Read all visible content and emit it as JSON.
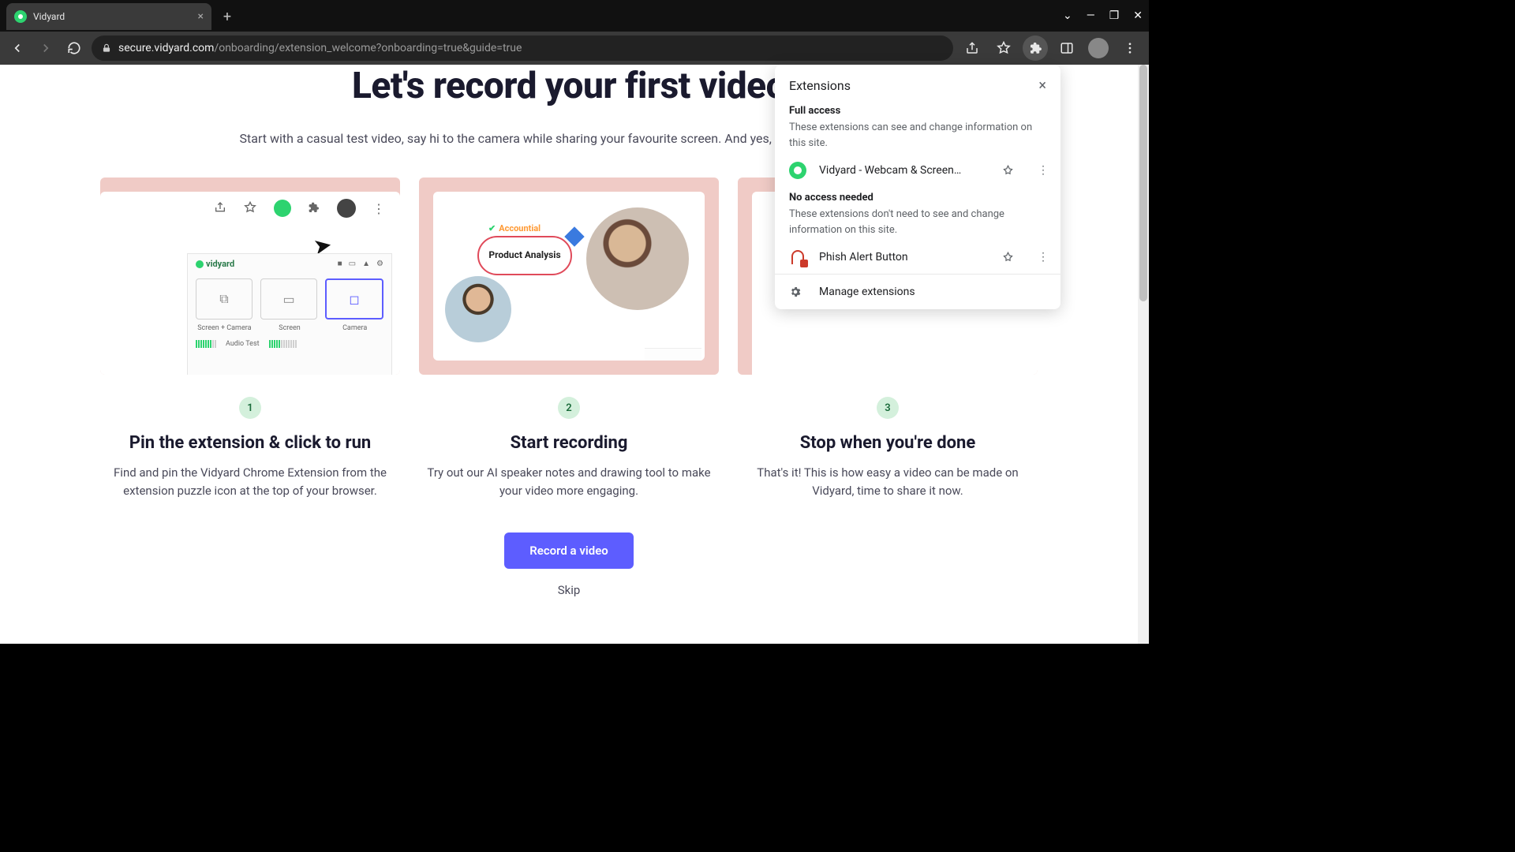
{
  "window": {
    "minimize": "—",
    "maximize": "❐",
    "close": "✕",
    "tabchevron": "⌄"
  },
  "tab": {
    "title": "Vidyard"
  },
  "address": {
    "domain": "secure.vidyard.com",
    "path": "/onboarding/extension_welcome?onboarding=true&guide=true"
  },
  "page": {
    "title": "Let's record your first video",
    "subtitle": "Start with a casual test video, say hi to the camera while sharing your favourite screen. And yes, you can delete it after.",
    "cta": "Record a video",
    "skip": "Skip"
  },
  "steps": [
    {
      "num": "1",
      "title": "Pin the extension & click to run",
      "desc": "Find and pin the Vidyard Chrome Extension from the extension puzzle icon at the top of your browser."
    },
    {
      "num": "2",
      "title": "Start recording",
      "desc": "Try out our AI speaker notes and drawing tool to make your video more engaging."
    },
    {
      "num": "3",
      "title": "Stop when you're done",
      "desc": "That's it! This is how easy a video can be made on Vidyard, time to share it now."
    }
  ],
  "mock1": {
    "logo": "vidyard",
    "opts": [
      "Screen + Camera",
      "Screen",
      "Camera"
    ],
    "audio": "Audio Test"
  },
  "mock2": {
    "brand": "Accountial",
    "bubble": "Product Analysis"
  },
  "ext": {
    "title": "Extensions",
    "full": {
      "heading": "Full access",
      "desc": "These extensions can see and change information on this site."
    },
    "none": {
      "heading": "No access needed",
      "desc": "These extensions don't need to see and change information on this site."
    },
    "items": [
      {
        "name": "Vidyard - Webcam & Screen…"
      },
      {
        "name": "Phish Alert Button"
      }
    ],
    "manage": "Manage extensions"
  }
}
